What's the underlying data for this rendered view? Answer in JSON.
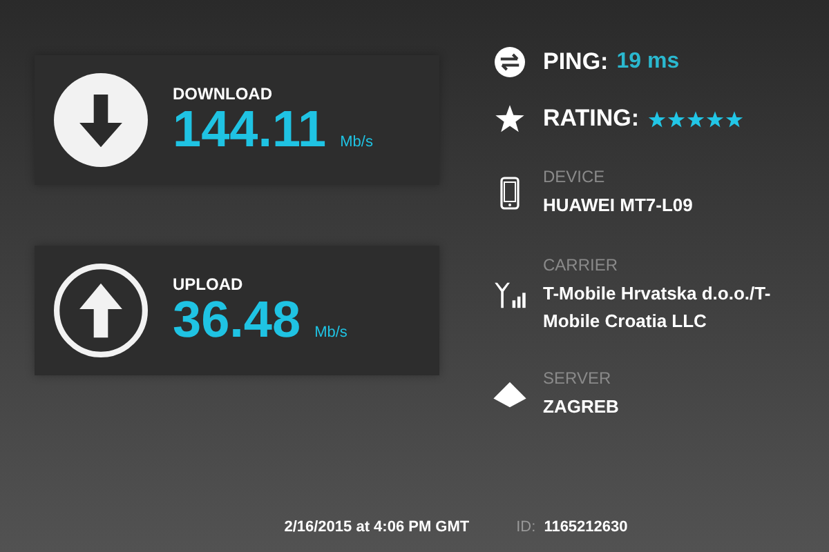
{
  "results": [
    {
      "kind": "download",
      "label": "DOWNLOAD",
      "value": "144.11",
      "unit": "Mb/s"
    },
    {
      "kind": "upload",
      "label": "UPLOAD",
      "value": "36.48",
      "unit": "Mb/s"
    }
  ],
  "details": [
    {
      "kind": "ping",
      "label": "PING:",
      "value": "19 ms"
    },
    {
      "kind": "rating",
      "label": "RATING:",
      "stars": 5
    },
    {
      "kind": "device",
      "label": "DEVICE",
      "value": "HUAWEI MT7-L09"
    },
    {
      "kind": "carrier",
      "label": "CARRIER",
      "value": "T-Mobile Hrvatska d.o.o./T-Mobile Croatia LLC"
    },
    {
      "kind": "server",
      "label": "SERVER",
      "value": "ZAGREB"
    }
  ],
  "footer": {
    "timestamp": "2/16/2015 at 4:06 PM GMT",
    "id_label": "ID:",
    "id_value": "1165212630"
  }
}
